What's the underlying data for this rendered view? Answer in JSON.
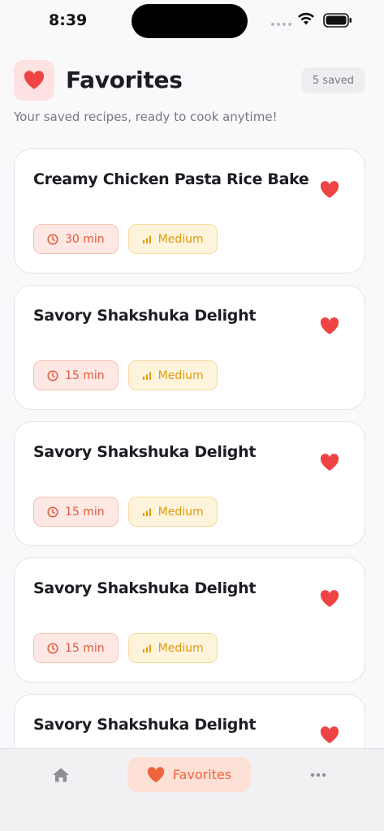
{
  "status_bar": {
    "time": "8:39"
  },
  "header": {
    "title": "Favorites",
    "saved_count": "5 saved",
    "subtitle": "Your saved recipes, ready to cook anytime!"
  },
  "recipes": [
    {
      "title": "Creamy Chicken Pasta Rice Bake",
      "time": "30 min",
      "difficulty": "Medium"
    },
    {
      "title": "Savory Shakshuka Delight",
      "time": "15 min",
      "difficulty": "Medium"
    },
    {
      "title": "Savory Shakshuka Delight",
      "time": "15 min",
      "difficulty": "Medium"
    },
    {
      "title": "Savory Shakshuka Delight",
      "time": "15 min",
      "difficulty": "Medium"
    },
    {
      "title": "Savory Shakshuka Delight",
      "time": "",
      "difficulty": ""
    }
  ],
  "tab_bar": {
    "favorites_label": "Favorites",
    "icons": [
      "home-icon",
      "heart-icon",
      "more-icon"
    ]
  },
  "colors": {
    "heart": "#ef4444",
    "accent": "#f0643c",
    "time_chip": "#e15a3a",
    "difficulty_chip": "#e19a0c"
  }
}
